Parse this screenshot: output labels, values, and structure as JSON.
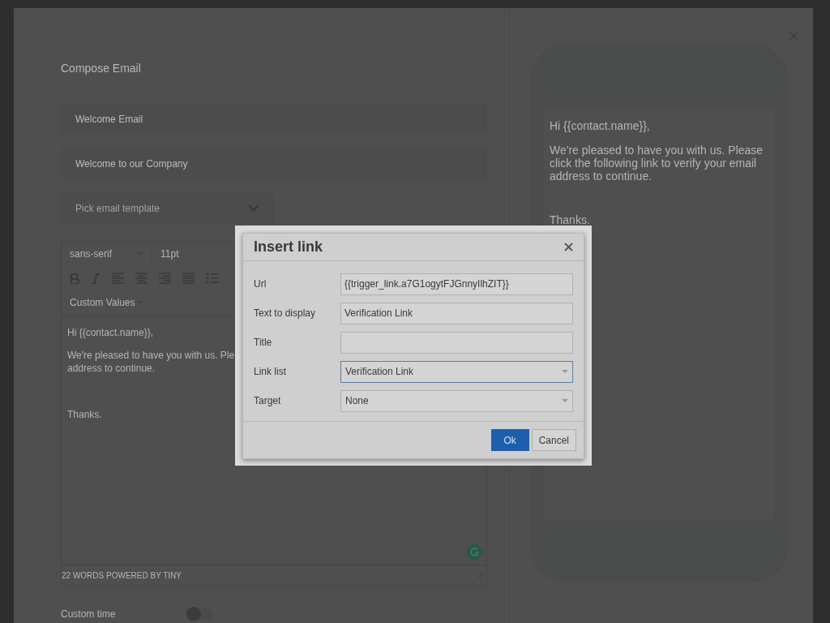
{
  "compose": {
    "title": "Compose Email",
    "fields": [
      {
        "kind": "text",
        "value": "Welcome Email"
      },
      {
        "kind": "text",
        "value": "Welcome to our Company"
      },
      {
        "kind": "select",
        "placeholder": "Pick email template"
      }
    ],
    "editor": {
      "font_family": "sans-serif",
      "font_size": "11pt",
      "custom_values": "Custom Values",
      "body": [
        {
          "kind": "line",
          "text": "Hi {{contact.name}},"
        },
        {
          "kind": "line",
          "text": "We're pleased to have you with us. Ple"
        },
        {
          "kind": "line",
          "text": "address to continue."
        },
        {
          "kind": "gap"
        },
        {
          "kind": "line",
          "text": "Thanks."
        }
      ],
      "status": "22 WORDS POWERED BY TINY"
    },
    "custom_time": {
      "label": "Custom time",
      "on": false
    }
  },
  "preview": {
    "greeting": "Hi {{contact.name}},",
    "paragraph": "We're pleased to have you with us. Please click the following link to verify your email address to continue.",
    "closing": "Thanks."
  },
  "dialog": {
    "title": "Insert link",
    "rows": [
      {
        "kind": "input",
        "label": "Url",
        "value": "{{trigger_link.a7G1ogytFJGnnyIlhZIT}}"
      },
      {
        "kind": "input",
        "label": "Text to display",
        "value": "Verification Link"
      },
      {
        "kind": "input",
        "label": "Title"
      },
      {
        "kind": "select",
        "label": "Link list",
        "value": "Verification Link",
        "focused": true
      },
      {
        "kind": "select",
        "label": "Target",
        "value": "None",
        "focused": false
      }
    ],
    "buttons": [
      {
        "label": "Ok",
        "primary": true
      },
      {
        "label": "Cancel",
        "primary": false
      }
    ]
  }
}
